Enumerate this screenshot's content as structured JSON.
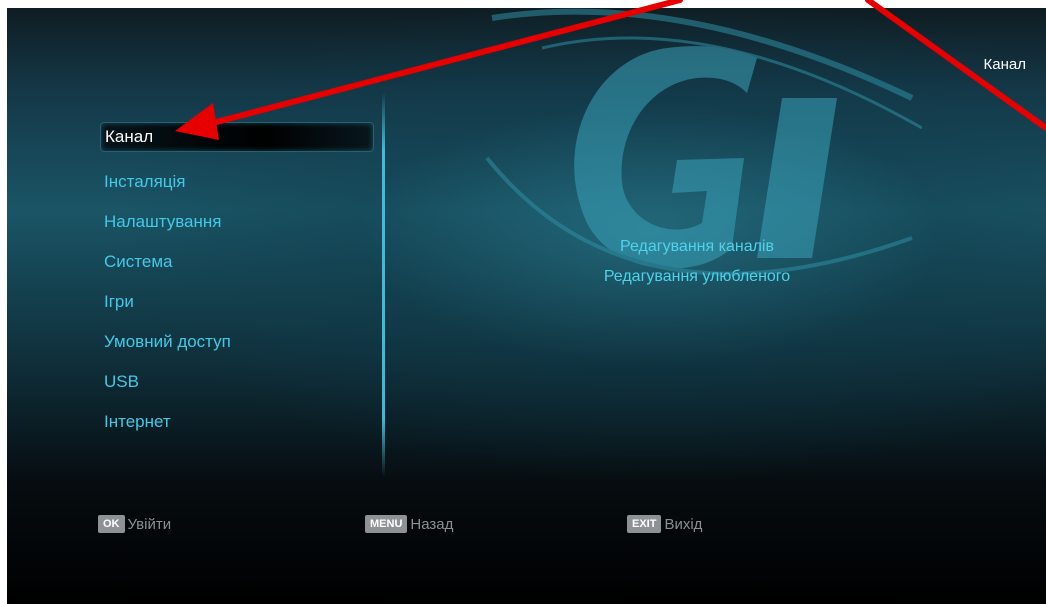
{
  "header": {
    "context_title": "Канал"
  },
  "main_menu": {
    "items": [
      {
        "label": "Канал",
        "selected": true
      },
      {
        "label": "Інсталяція",
        "selected": false
      },
      {
        "label": "Налаштування",
        "selected": false
      },
      {
        "label": "Система",
        "selected": false
      },
      {
        "label": "Ігри",
        "selected": false
      },
      {
        "label": "Умовний доступ",
        "selected": false
      },
      {
        "label": "USB",
        "selected": false
      },
      {
        "label": "Інтернет",
        "selected": false
      }
    ]
  },
  "submenu": {
    "items": [
      {
        "label": "Редагування каналів"
      },
      {
        "label": "Редагування улюбленого"
      }
    ]
  },
  "footer": {
    "ok": {
      "key": "OK",
      "label": "Увійти"
    },
    "menu": {
      "key": "MENU",
      "label": "Назад"
    },
    "exit": {
      "key": "EXIT",
      "label": "Вихід"
    }
  },
  "colors": {
    "menu_text": "#43c9e6",
    "selected_text": "#ffffff",
    "annotation_arrow": "#e60000"
  },
  "icons": {
    "logo": "gi-logo",
    "annotation": "red-arrow-annotation"
  }
}
